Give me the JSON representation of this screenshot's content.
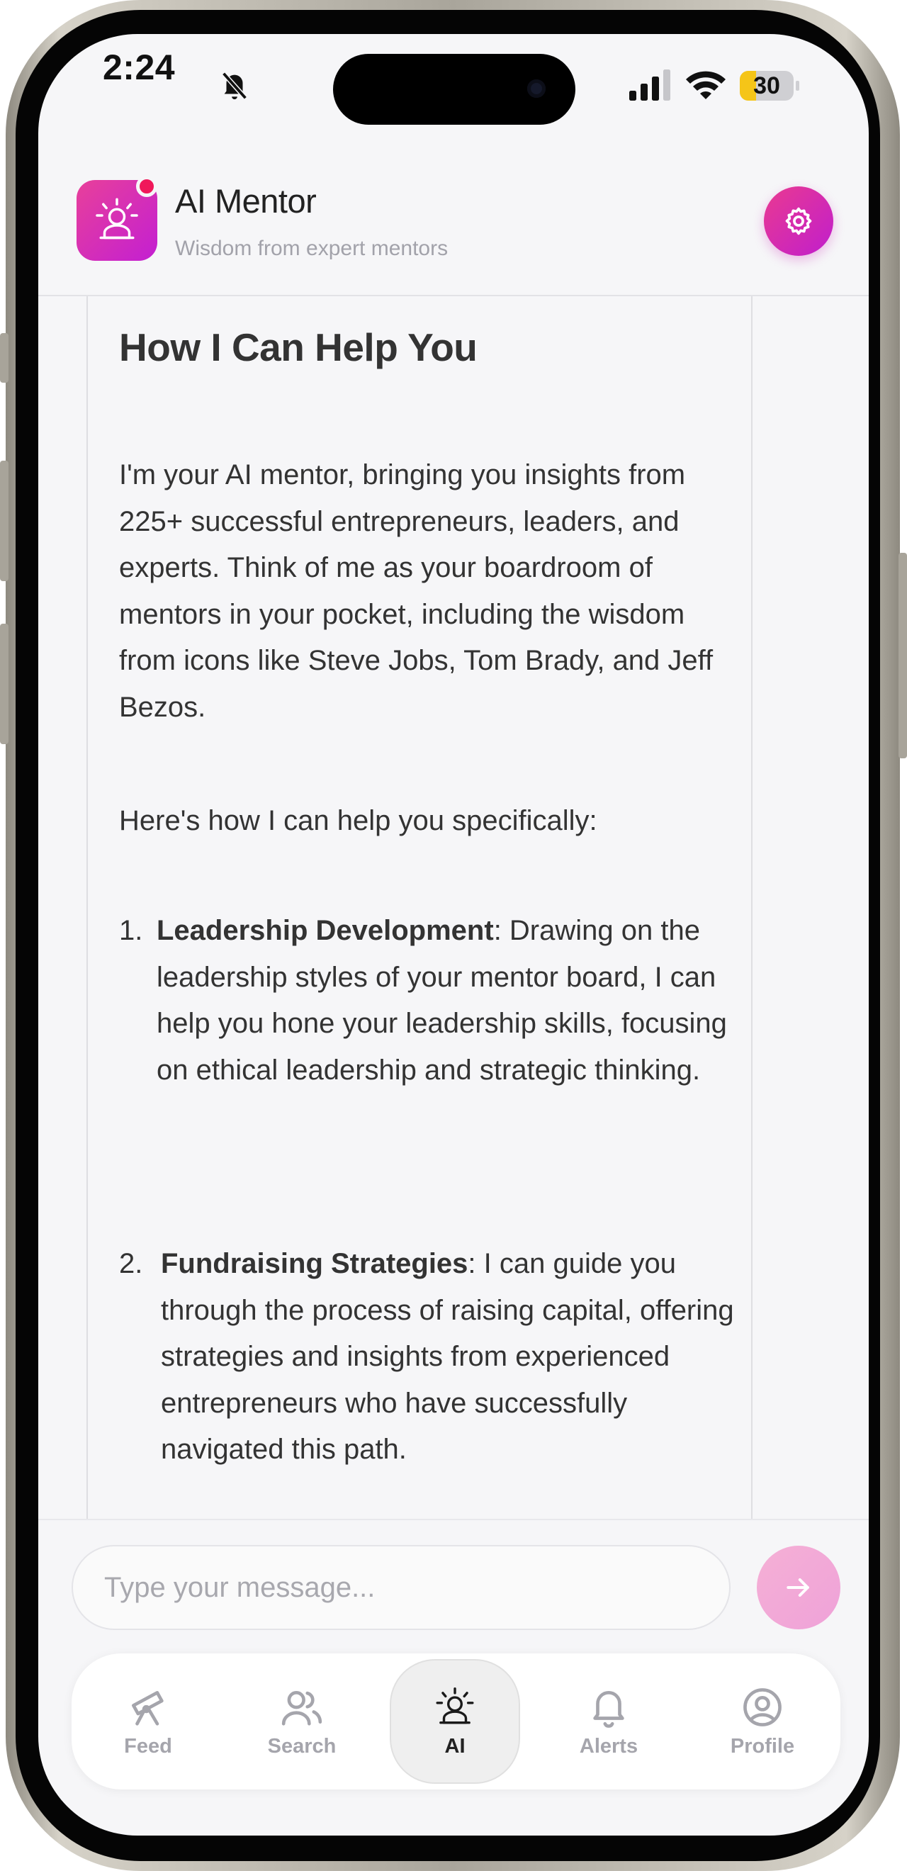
{
  "status_bar": {
    "time": "2:24",
    "battery_level": "30",
    "battery_fraction": 0.3
  },
  "header": {
    "app_title": "AI Mentor",
    "app_subtitle": "Wisdom from expert mentors",
    "accent_color": "#d42bb8"
  },
  "message": {
    "heading": "How I Can Help You",
    "intro": "I'm your AI mentor, bringing you insights from 225+ successful entrepreneurs, leaders, and experts. Think of me as your boardroom of mentors in your pocket, including the wisdom from icons like Steve Jobs, Tom Brady, and Jeff Bezos.",
    "lead_in": "Here's how I can help you specifically:",
    "list": [
      {
        "number": "1.",
        "title": "Leadership Development",
        "text": ": Drawing on the leadership styles of your mentor board, I can help you hone your leadership skills, focusing on ethical leadership and strategic thinking."
      },
      {
        "number": "2.",
        "title": "Fundraising Strategies",
        "text": ": I can guide you through the process of raising capital, offering strategies and insights from experienced entrepreneurs who have successfully navigated this path."
      }
    ]
  },
  "composer": {
    "placeholder": "Type your message..."
  },
  "nav": {
    "items": [
      {
        "label": "Feed",
        "icon": "telescope-icon"
      },
      {
        "label": "Search",
        "icon": "users-icon"
      },
      {
        "label": "AI",
        "icon": "mentor-icon",
        "active": true
      },
      {
        "label": "Alerts",
        "icon": "bell-icon"
      },
      {
        "label": "Profile",
        "icon": "profile-icon"
      }
    ]
  }
}
